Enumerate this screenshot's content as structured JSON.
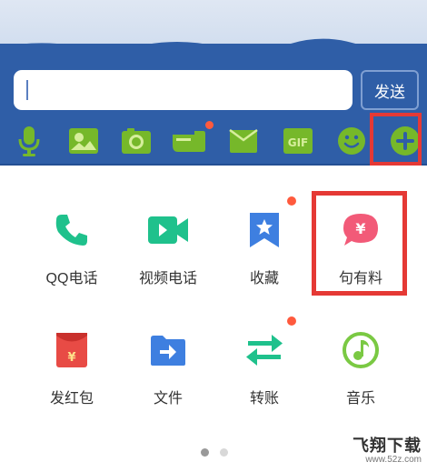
{
  "chat": {
    "input_value": "",
    "send_label": "发送"
  },
  "toolbar": {
    "items": [
      {
        "icon": "microphone-icon",
        "badge": false
      },
      {
        "icon": "image-icon",
        "badge": false
      },
      {
        "icon": "camera-icon",
        "badge": false
      },
      {
        "icon": "red-packet-icon",
        "badge": true
      },
      {
        "icon": "folder-icon",
        "badge": false
      },
      {
        "icon": "gif-icon",
        "badge": false
      },
      {
        "icon": "emoji-icon",
        "badge": false
      },
      {
        "icon": "plus-icon",
        "badge": false
      }
    ]
  },
  "panel": {
    "items": [
      {
        "label": "QQ电话",
        "icon": "phone-icon",
        "color": "#1fc18c",
        "badge": false
      },
      {
        "label": "视频电话",
        "icon": "video-call-icon",
        "color": "#1fc18c",
        "badge": false
      },
      {
        "label": "收藏",
        "icon": "bookmark-star-icon",
        "color": "#3e7fe0",
        "badge": true
      },
      {
        "label": "句有料",
        "icon": "yen-bubble-icon",
        "color": "#f25a78",
        "badge": false
      },
      {
        "label": "发红包",
        "icon": "red-envelope-icon",
        "color": "#e84b45",
        "badge": false
      },
      {
        "label": "文件",
        "icon": "file-transfer-icon",
        "color": "#3e7fe0",
        "badge": false
      },
      {
        "label": "转账",
        "icon": "transfer-arrows-icon",
        "color": "#1fc18c",
        "badge": true
      },
      {
        "label": "音乐",
        "icon": "music-note-icon",
        "color": "#7ac943",
        "badge": false
      }
    ],
    "page_count": 2,
    "active_page": 1
  },
  "watermark": {
    "title": "飞翔下载",
    "url": "www.52z.com"
  },
  "colors": {
    "chat_bar": "#2f5ea7",
    "toolbar_icon": "#76b82a",
    "highlight": "#e53935",
    "badge": "#ff5a3d"
  }
}
